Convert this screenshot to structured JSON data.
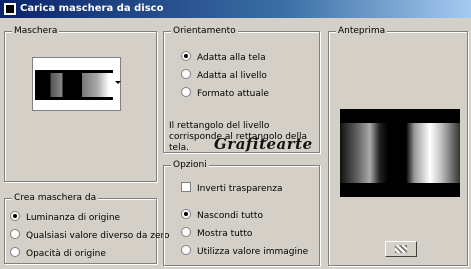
{
  "window": {
    "title": "Carica maschera da disco"
  },
  "maschera": {
    "label": "Maschera"
  },
  "crea": {
    "label": "Crea maschera da",
    "options": [
      "Luminanza di origine",
      "Qualsiasi valore diverso da zero",
      "Opacità di origine"
    ],
    "selected_index": 0
  },
  "orientamento": {
    "label": "Orientamento",
    "options": [
      "Adatta alla tela",
      "Adatta al livello",
      "Formato attuale"
    ],
    "selected_index": 0,
    "note": "Il rettangolo del livello corrisponde al rettangolo della tela."
  },
  "opzioni": {
    "label": "Opzioni",
    "invert_label": "Inverti trasparenza",
    "invert_checked": false,
    "options": [
      "Nascondi tutto",
      "Mostra tutto",
      "Utilizza valore immagine"
    ],
    "selected_index": 0
  },
  "anteprima": {
    "label": "Anteprima"
  },
  "watermark": "Grafitearte",
  "icons": {
    "app": "dialog-app-icon",
    "dropdown": "chevron-down-icon",
    "transparency": "checkerboard-icon"
  }
}
